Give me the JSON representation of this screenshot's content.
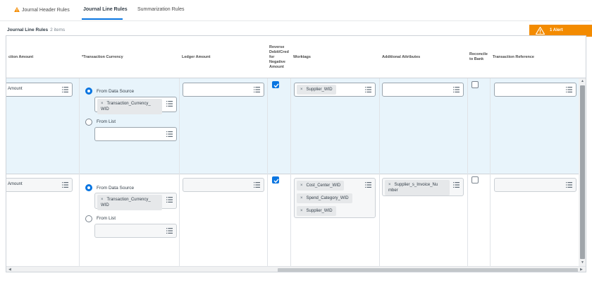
{
  "tabs": [
    {
      "label": "Journal Header Rules"
    },
    {
      "label": "Journal Line Rules"
    },
    {
      "label": "Summarization Rules"
    }
  ],
  "section": {
    "title": "Journal Line Rules",
    "count": "2 items"
  },
  "alert": {
    "label": "1 Alert"
  },
  "columns": {
    "transaction_amount": "ction Amount",
    "transaction_currency": "*Transaction Currency",
    "ledger_amount": "Ledger Amount",
    "reverse": "Reverse Debit/Cred for Negative Amount",
    "worktags": "Worktags",
    "additional_attributes": "Additional Attributes",
    "reconcile": "Reconcile to Bank",
    "transaction_reference": "Transaction Reference"
  },
  "rows": [
    {
      "amount": "Amount",
      "currency_option_source": "From Data Source",
      "currency_source_value": "Transaction_Currency_ WID",
      "currency_option_list": "From List",
      "reverse_checked": true,
      "worktags": [
        "Supplier_WID"
      ],
      "attributes": [],
      "reconcile_checked": false
    },
    {
      "amount": "Amount",
      "currency_option_source": "From Data Source",
      "currency_source_value": "Transaction_Currency_ WID",
      "currency_option_list": "From List",
      "reverse_checked": true,
      "worktags": [
        "Cost_Center_WID",
        "Spend_Category_WID",
        "Supplier_WID"
      ],
      "attributes": [
        "Supplier_s_Invoice_Nu mber"
      ],
      "reconcile_checked": false
    }
  ],
  "icons": {
    "prompt": "list-prompt-icon",
    "remove": "×",
    "warning": "warning-triangle-icon",
    "check": "checkmark-icon"
  },
  "colors": {
    "accent": "#0875e1",
    "alert": "#f38b00",
    "selected_row": "#e8f4fb"
  }
}
